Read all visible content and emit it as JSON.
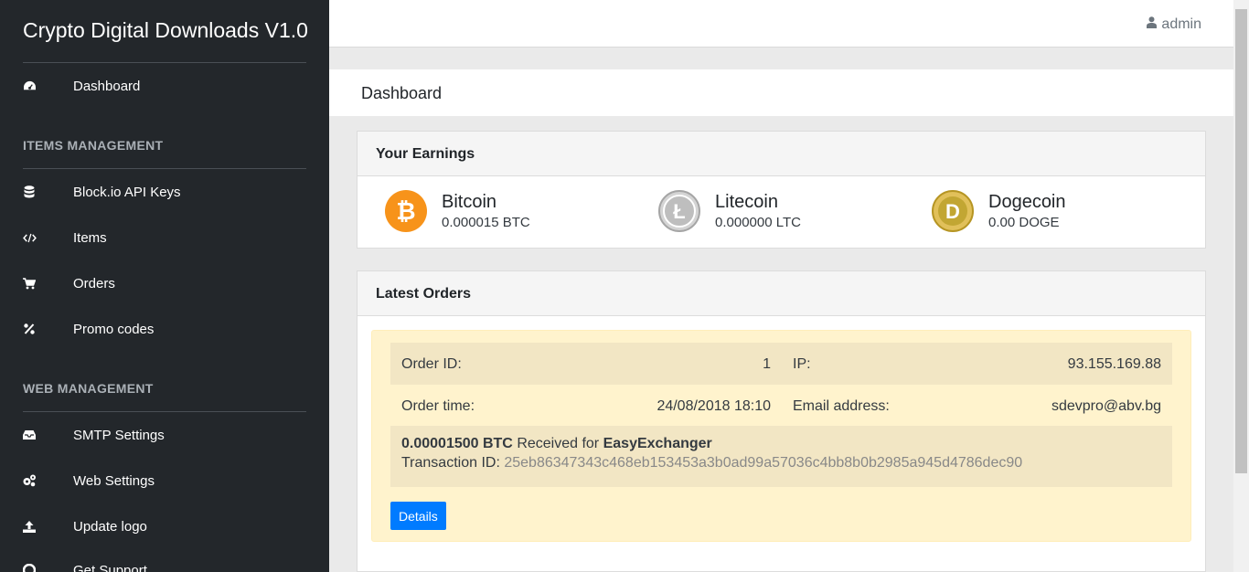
{
  "brand": "Crypto Digital Downloads V1.0",
  "sidebar": {
    "dashboard": {
      "label": "Dashboard",
      "icon": "dashboard-icon"
    },
    "items_section": "ITEMS MANAGEMENT",
    "items_nav": [
      {
        "label": "Block.io API Keys",
        "icon": "database-icon"
      },
      {
        "label": "Items",
        "icon": "code-icon"
      },
      {
        "label": "Orders",
        "icon": "cart-icon"
      },
      {
        "label": "Promo codes",
        "icon": "percent-icon"
      }
    ],
    "web_section": "WEB MANAGEMENT",
    "web_nav": [
      {
        "label": "SMTP Settings",
        "icon": "inbox-icon"
      },
      {
        "label": "Web Settings",
        "icon": "gears-icon"
      },
      {
        "label": "Update logo",
        "icon": "upload-icon"
      },
      {
        "label": "Get Support",
        "icon": "support-icon"
      }
    ]
  },
  "topbar": {
    "user": "admin",
    "user_icon": "user-icon"
  },
  "page": {
    "title": "Dashboard"
  },
  "earnings": {
    "title_prefix": "Your",
    "title_bold": "Earnings",
    "coins": [
      {
        "name": "Bitcoin",
        "amount": "0.000015 BTC",
        "icon": "bitcoin-icon",
        "color": "#f7931a"
      },
      {
        "name": "Litecoin",
        "amount": "0.000000 LTC",
        "icon": "litecoin-icon",
        "color": "#bebebe"
      },
      {
        "name": "Dogecoin",
        "amount": "0.00 DOGE",
        "icon": "dogecoin-icon",
        "color": "#c2a633"
      }
    ]
  },
  "orders": {
    "title_prefix": "Latest",
    "title_bold": "Orders",
    "order": {
      "id_label": "Order ID:",
      "id": "1",
      "ip_label": "IP:",
      "ip": "93.155.169.88",
      "time_label": "Order time:",
      "time": "24/08/2018 18:10",
      "email_label": "Email address:",
      "email": "sdevpro@abv.bg",
      "amount": "0.00001500 BTC",
      "received_text": "Received for",
      "product": "EasyExchanger",
      "tx_label": "Transaction ID:",
      "tx_hash": "25eb86347343c468eb153453a3b0ad99a57036c4bb8b0b2985a945d4786dec90",
      "details_label": "Details"
    }
  },
  "colors": {
    "sidebar_bg": "#23272b",
    "accent": "#007bff",
    "order_bg": "#fff3cd"
  }
}
